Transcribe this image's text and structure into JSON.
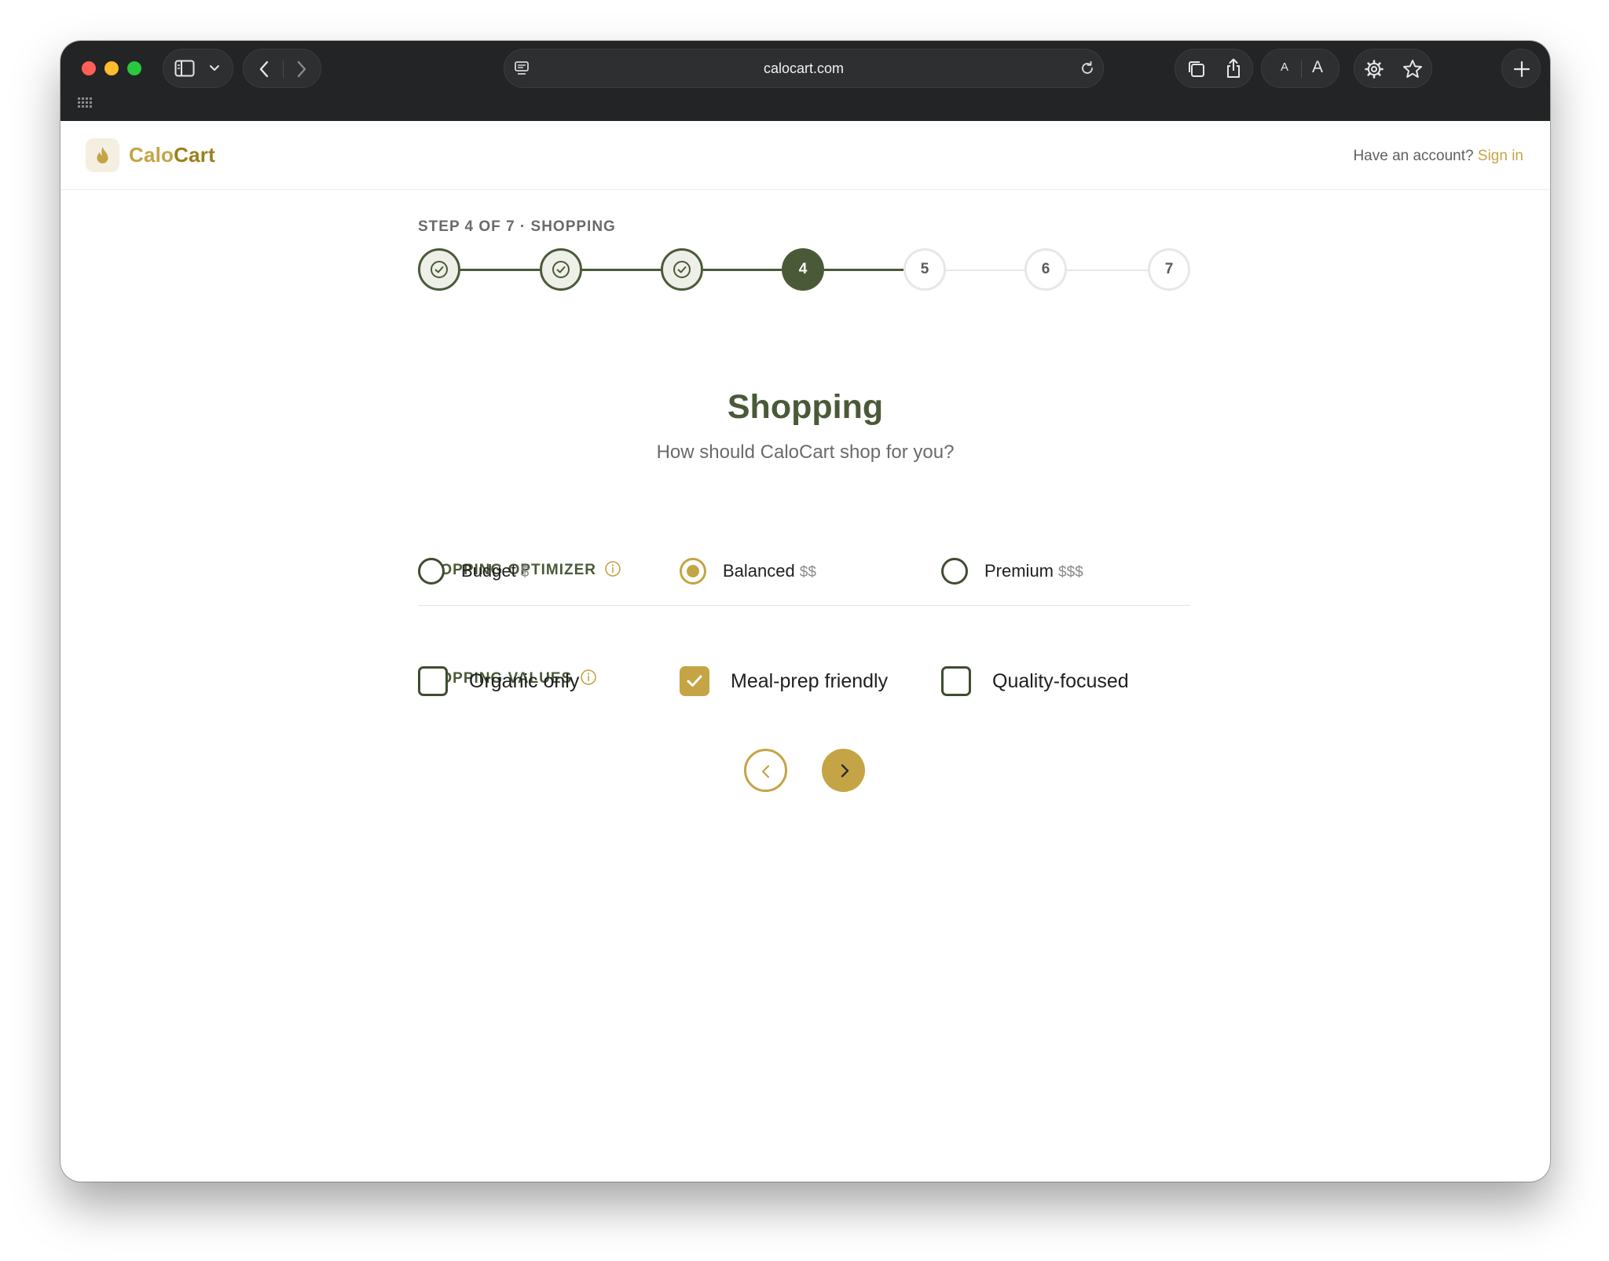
{
  "browser": {
    "url": "calocart.com",
    "icons": [
      "sidebar-icon",
      "chevron-down-icon",
      "back-arrow-icon",
      "forward-arrow-icon",
      "reader-icon",
      "reload-icon",
      "tabs-icon",
      "share-icon",
      "text-smaller-icon",
      "text-larger-icon",
      "gear-icon",
      "star-icon",
      "plus-icon",
      "grid-icon"
    ],
    "text_small": "A",
    "text_large": "A"
  },
  "header": {
    "brand_part1": "Calo",
    "brand_part2": "Cart",
    "account_prompt": "Have an account?",
    "signin_label": "Sign in"
  },
  "stepper": {
    "label": "STEP 4 OF 7 · SHOPPING",
    "current": 4,
    "total": 7,
    "steps": [
      {
        "label": "1",
        "status": "done"
      },
      {
        "label": "2",
        "status": "done"
      },
      {
        "label": "3",
        "status": "done"
      },
      {
        "label": "4",
        "status": "current"
      },
      {
        "label": "5",
        "status": "todo"
      },
      {
        "label": "6",
        "status": "todo"
      },
      {
        "label": "7",
        "status": "todo"
      }
    ]
  },
  "page": {
    "title": "Shopping",
    "subtitle": "How should CaloCart shop for you?"
  },
  "optimizer": {
    "label": "SHOPPING OPTIMIZER",
    "options": [
      {
        "label": "Budget",
        "price": "$",
        "selected": false
      },
      {
        "label": "Balanced",
        "price": "$$",
        "selected": true
      },
      {
        "label": "Premium",
        "price": "$$$",
        "selected": false
      }
    ]
  },
  "values": {
    "label": "SHOPPING VALUES",
    "options": [
      {
        "label": "Organic only",
        "checked": false
      },
      {
        "label": "Meal-prep friendly",
        "checked": true
      },
      {
        "label": "Quality-focused",
        "checked": false
      }
    ]
  },
  "colors": {
    "primary_green": "#4a5a38",
    "accent_gold": "#c4a445",
    "chrome_dark": "#232425"
  }
}
